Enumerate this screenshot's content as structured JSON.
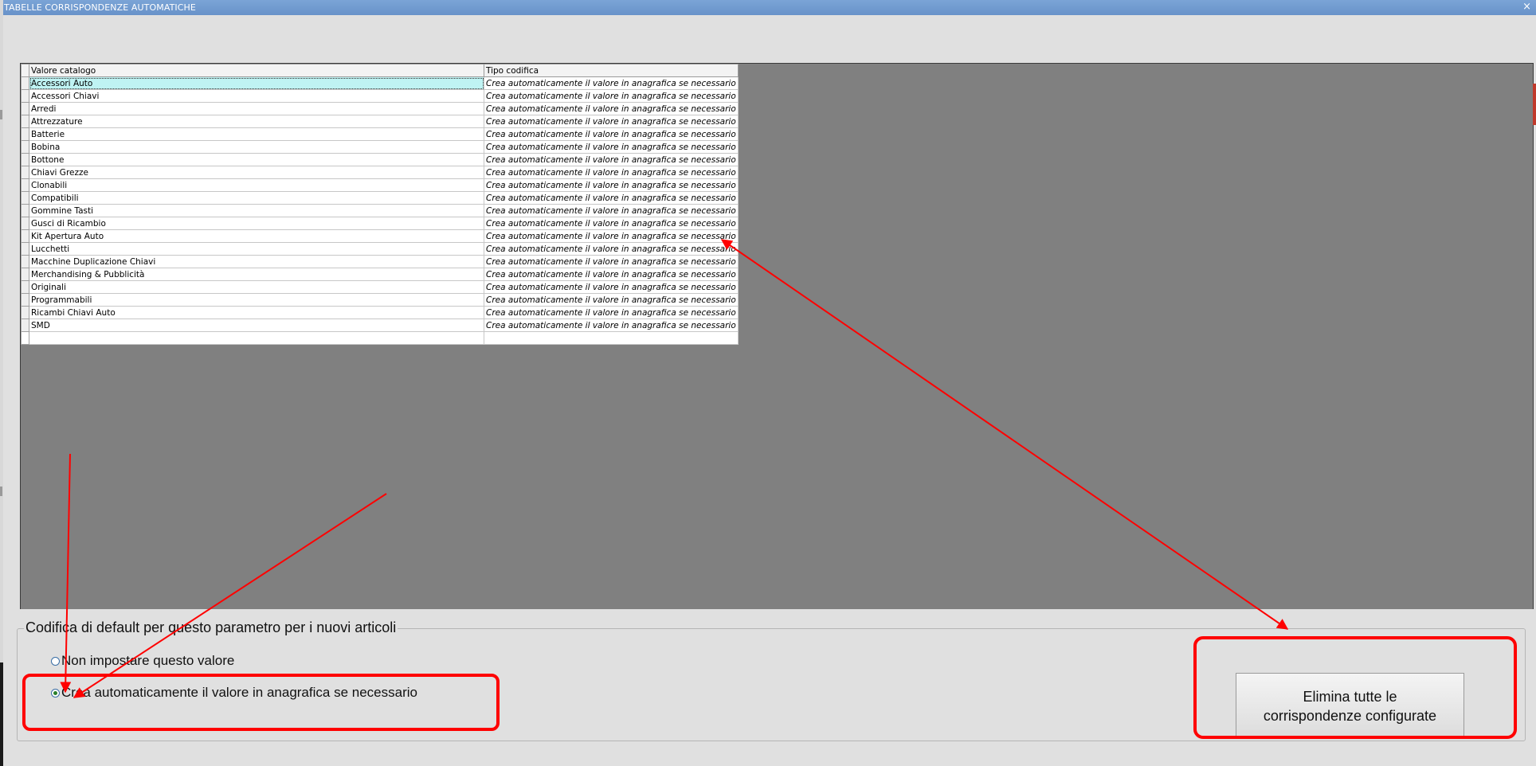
{
  "window": {
    "title": "TABELLE CORRISPONDENZE AUTOMATICHE",
    "close_glyph": "×"
  },
  "grid": {
    "columns": [
      "Valore catalogo",
      "Tipo codifica"
    ],
    "rows": [
      {
        "value": "Accessori Auto",
        "type": "Crea automaticamente il valore in anagrafica se necessario"
      },
      {
        "value": "Accessori Chiavi",
        "type": "Crea automaticamente il valore in anagrafica se necessario"
      },
      {
        "value": "Arredi",
        "type": "Crea automaticamente il valore in anagrafica se necessario"
      },
      {
        "value": "Attrezzature",
        "type": "Crea automaticamente il valore in anagrafica se necessario"
      },
      {
        "value": "Batterie",
        "type": "Crea automaticamente il valore in anagrafica se necessario"
      },
      {
        "value": "Bobina",
        "type": "Crea automaticamente il valore in anagrafica se necessario"
      },
      {
        "value": "Bottone",
        "type": "Crea automaticamente il valore in anagrafica se necessario"
      },
      {
        "value": "Chiavi Grezze",
        "type": "Crea automaticamente il valore in anagrafica se necessario"
      },
      {
        "value": "Clonabili",
        "type": "Crea automaticamente il valore in anagrafica se necessario"
      },
      {
        "value": "Compatibili",
        "type": "Crea automaticamente il valore in anagrafica se necessario"
      },
      {
        "value": "Gommine Tasti",
        "type": "Crea automaticamente il valore in anagrafica se necessario"
      },
      {
        "value": "Gusci di Ricambio",
        "type": "Crea automaticamente il valore in anagrafica se necessario"
      },
      {
        "value": "Kit Apertura Auto",
        "type": "Crea automaticamente il valore in anagrafica se necessario"
      },
      {
        "value": "Lucchetti",
        "type": "Crea automaticamente il valore in anagrafica se necessario"
      },
      {
        "value": "Macchine Duplicazione Chiavi",
        "type": "Crea automaticamente il valore in anagrafica se necessario"
      },
      {
        "value": "Merchandising & Pubblicità",
        "type": "Crea automaticamente il valore in anagrafica se necessario"
      },
      {
        "value": "Originali",
        "type": "Crea automaticamente il valore in anagrafica se necessario"
      },
      {
        "value": "Programmabili",
        "type": "Crea automaticamente il valore in anagrafica se necessario"
      },
      {
        "value": "Ricambi Chiavi Auto",
        "type": "Crea automaticamente il valore in anagrafica se necessario"
      },
      {
        "value": "SMD",
        "type": "Crea automaticamente il valore in anagrafica se necessario"
      }
    ],
    "selected_row": 0
  },
  "default_group": {
    "legend": "Codifica di default per questo parametro per i nuovi articoli",
    "options": [
      {
        "label": "Non impostare questo valore",
        "checked": false
      },
      {
        "label": "Crea automaticamente il valore in anagrafica se necessario",
        "checked": true
      }
    ]
  },
  "delete_button": {
    "label": "Elimina tutte le corrispondenze configurate"
  },
  "colors": {
    "title_bar": "#6f98cd",
    "annotation": "#ff0000",
    "grid_background": "#808080",
    "selected_cell": "#bff3f3"
  }
}
